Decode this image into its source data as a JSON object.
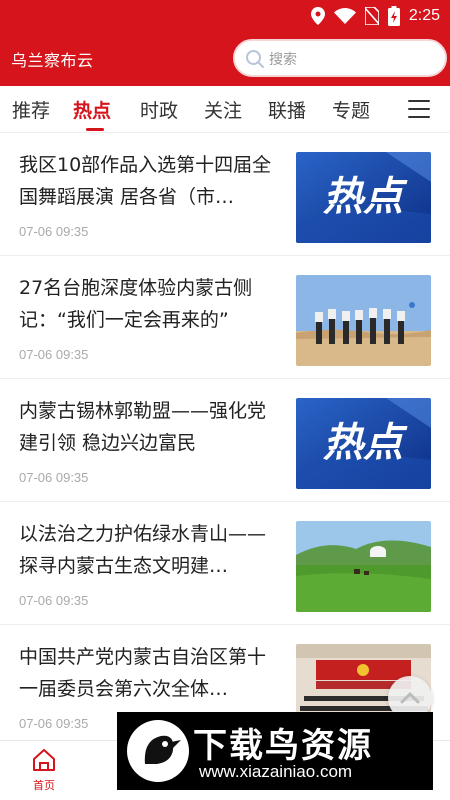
{
  "status_bar": {
    "time": "2:25",
    "icons": [
      "location-icon",
      "wifi-icon",
      "no-sim-icon",
      "battery-icon"
    ]
  },
  "header": {
    "app_title": "乌兰察布云",
    "search_placeholder": "搜索"
  },
  "tabs": [
    {
      "label": "推荐"
    },
    {
      "label": "热点",
      "active": true
    },
    {
      "label": "时政"
    },
    {
      "label": "关注"
    },
    {
      "label": "联播"
    },
    {
      "label": "专题"
    }
  ],
  "news": [
    {
      "title": "我区10部作品入选第十四届全国舞蹈展演 居各省（市…",
      "time": "07-06 09:35",
      "thumb": "热点"
    },
    {
      "title": "27名台胞深度体验内蒙古侧记：“我们一定会再来的”",
      "time": "07-06 09:35",
      "thumb": "desert-group-photo"
    },
    {
      "title": "内蒙古锡林郭勒盟——强化党建引领 稳边兴边富民",
      "time": "07-06 09:35",
      "thumb": "热点"
    },
    {
      "title": "以法治之力护佑绿水青山——探寻内蒙古生态文明建…",
      "time": "07-06 09:35",
      "thumb": "grassland-photo"
    },
    {
      "title": "中国共产党内蒙古自治区第十一届委员会第六次全体…",
      "time": "07-06 09:35",
      "thumb": "meeting-hall-photo"
    }
  ],
  "bottom_nav": {
    "home_label": "首页"
  },
  "watermark": {
    "title": "下载鸟资源",
    "url": "www.xiazainiao.com"
  },
  "colors": {
    "brand_red": "#d6141b",
    "hot_blue": "#1a4aa8"
  }
}
